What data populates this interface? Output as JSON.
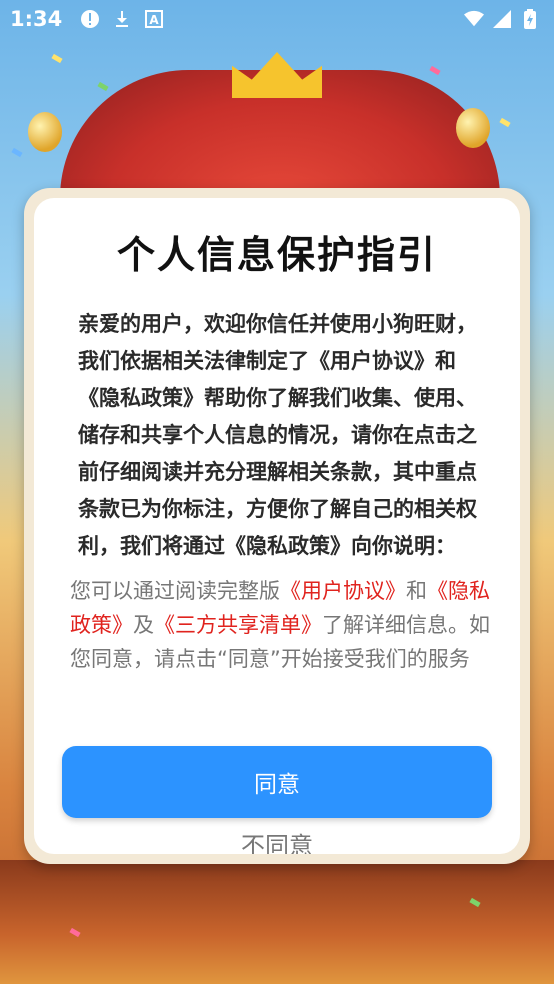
{
  "status_bar": {
    "time": "1:34",
    "left_icons": [
      "alert-icon",
      "download-icon",
      "a-icon"
    ],
    "right_icons": [
      "wifi-icon",
      "signal-icon",
      "battery-icon"
    ]
  },
  "dialog": {
    "title": "个人信息保护指引",
    "body": "亲爱的用户，欢迎你信任并使用小狗旺财，我们依据相关法律制定了《用户协议》和《隐私政策》帮助你了解我们收集、使用、储存和共享个人信息的情况，请你在点击之前仔细阅读并充分理解相关条款，其中重点条款已为你标注，方便你了解自己的相关权利，我们将通过《隐私政策》向你说明：",
    "note_prefix": "您可以通过阅读完整版",
    "link_user_agreement": "《用户协议》",
    "note_and": "和",
    "link_privacy": "《隐私政策》",
    "note_and2": "及",
    "link_third_party": "《三方共享清单》",
    "note_suffix": "了解详细信息。如您同意，请点击“同意”开始接受我们的服务",
    "agree_label": "同意",
    "disagree_label": "不同意"
  },
  "colors": {
    "accent": "#2c93ff",
    "link": "#e0231e",
    "frame": "#f3e9d6"
  }
}
